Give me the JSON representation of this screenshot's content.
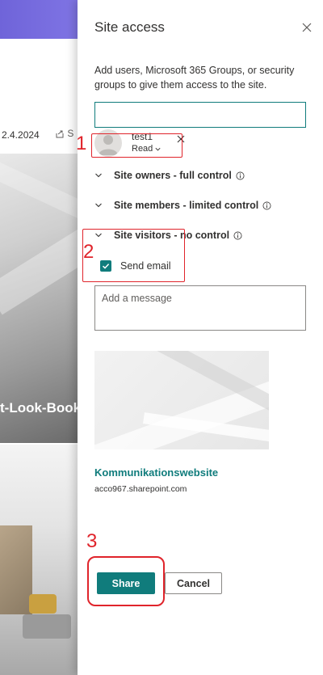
{
  "background": {
    "date": "2.4.2024",
    "share_label": "S",
    "hero_title": "t-Look-Book"
  },
  "panel": {
    "title": "Site access",
    "description": "Add users, Microsoft 365 Groups, or security groups to give them access to the site.",
    "user": {
      "name": "test1",
      "permission": "Read"
    },
    "groups": [
      {
        "label": "Site owners - full control"
      },
      {
        "label": "Site members - limited control"
      },
      {
        "label": "Site visitors - no control"
      }
    ],
    "send_email_label": "Send email",
    "send_email_checked": true,
    "message_placeholder": "Add a message",
    "site": {
      "name": "Kommunikationswebsite",
      "url": "acco967.sharepoint.com"
    },
    "share_label": "Share",
    "cancel_label": "Cancel"
  },
  "annotations": {
    "step1": "1",
    "step2": "2",
    "step3": "3",
    "color": "#e0242b"
  },
  "colors": {
    "accent": "#107c7c",
    "header": "#7066dc"
  }
}
